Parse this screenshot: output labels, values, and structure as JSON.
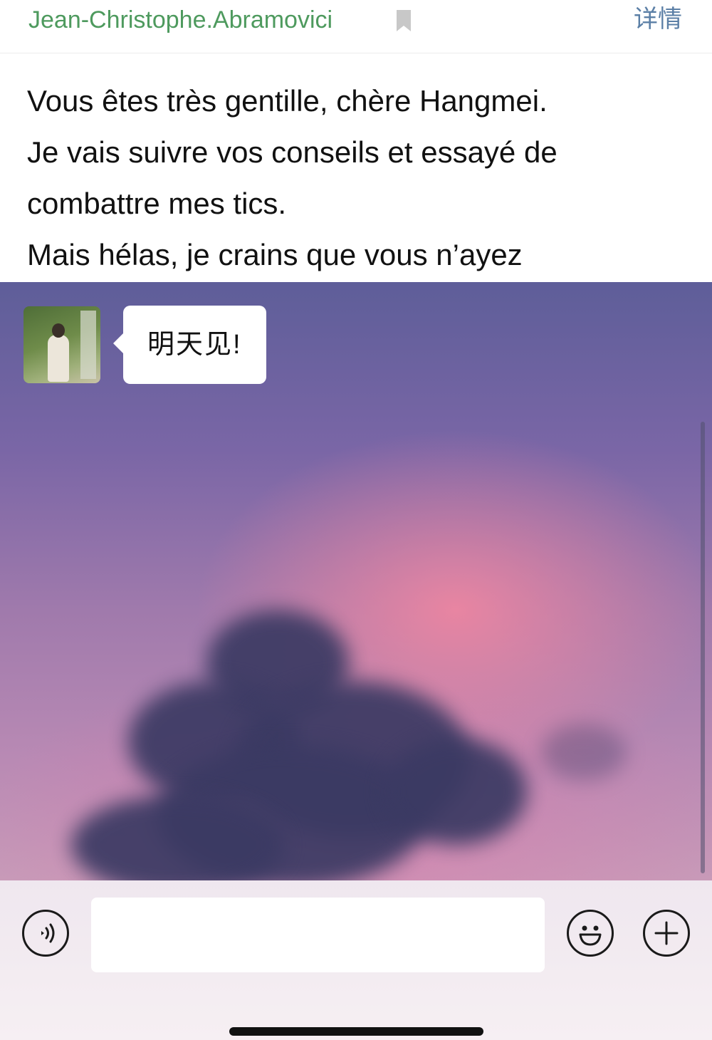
{
  "header": {
    "sender": "Jean-Christophe.Abramovici",
    "detail_link": "详情",
    "bookmark_icon": "bookmark-icon"
  },
  "message": {
    "lines": [
      "Vous êtes très gentille, chère Hangmei.",
      "Je vais suivre vos conseils et essayé de",
      "combattre mes tics.",
      "Mais hélas, je crains que vous n’ayez"
    ]
  },
  "chat": {
    "bubble_text": "明天见!",
    "avatar_icon": "avatar"
  },
  "input_bar": {
    "voice_icon": "voice-icon",
    "text_value": "",
    "emoji_icon": "emoji-icon",
    "plus_icon": "plus-icon"
  },
  "colors": {
    "sender": "#4e9a5e",
    "detail_link": "#5b7fa6",
    "bubble": "#ffffff"
  }
}
